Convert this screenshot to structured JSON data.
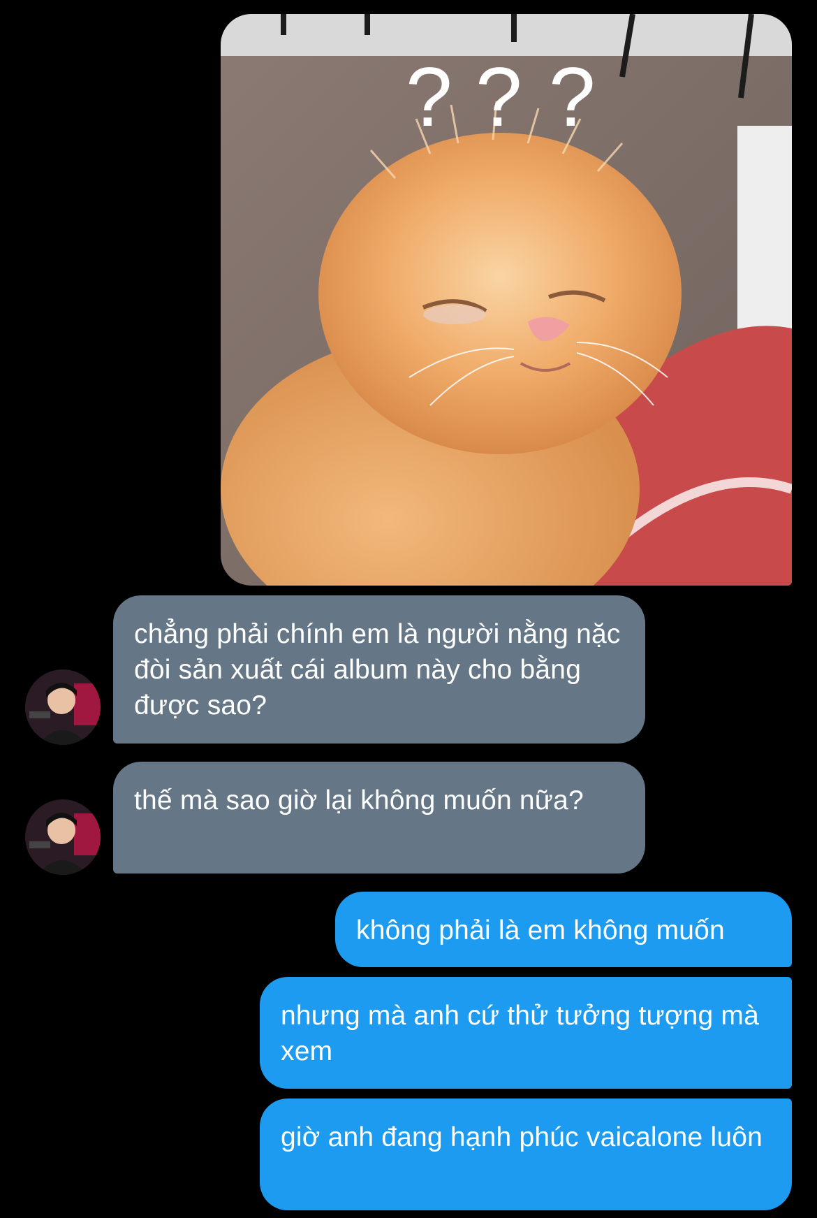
{
  "conversation": {
    "shared_image": {
      "overlay_text": "???",
      "icon": "kitten-meme-image"
    },
    "messages": [
      {
        "side": "received",
        "text": "chẳng phải chính em là người nằng nặc đòi sản xuất cái album này cho bằng được sao?"
      },
      {
        "side": "received",
        "text": "thế mà sao giờ lại không muốn nữa?"
      },
      {
        "side": "sent",
        "text": "không phải là em không muốn"
      },
      {
        "side": "sent",
        "text": "nhưng mà anh cứ thử tưởng tượng mà xem"
      },
      {
        "side": "sent",
        "text": "giờ anh đang hạnh phúc vaicalone luôn"
      }
    ]
  },
  "colors": {
    "background": "#000000",
    "received_bubble": "#657786",
    "sent_bubble": "#1d9bf0",
    "text": "#ffffff"
  }
}
